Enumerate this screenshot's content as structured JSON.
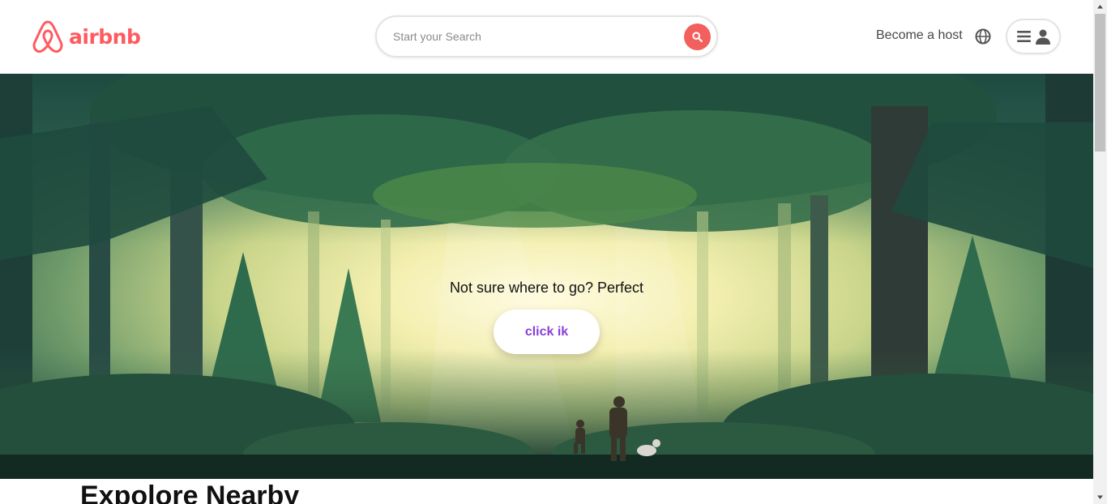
{
  "header": {
    "logo_text": "airbnb",
    "search_placeholder": "Start your Search",
    "host_link": "Become a host",
    "icons": {
      "search": "search-icon",
      "globe": "globe-icon",
      "menu": "hamburger-icon",
      "user": "user-icon"
    },
    "brand_color": "#ff5a5f"
  },
  "hero": {
    "tagline": "Not sure where to go? Perfect",
    "cta_label": "click ik",
    "cta_color": "#8a3fd8"
  },
  "explore": {
    "title": "Expolore Nearby"
  }
}
